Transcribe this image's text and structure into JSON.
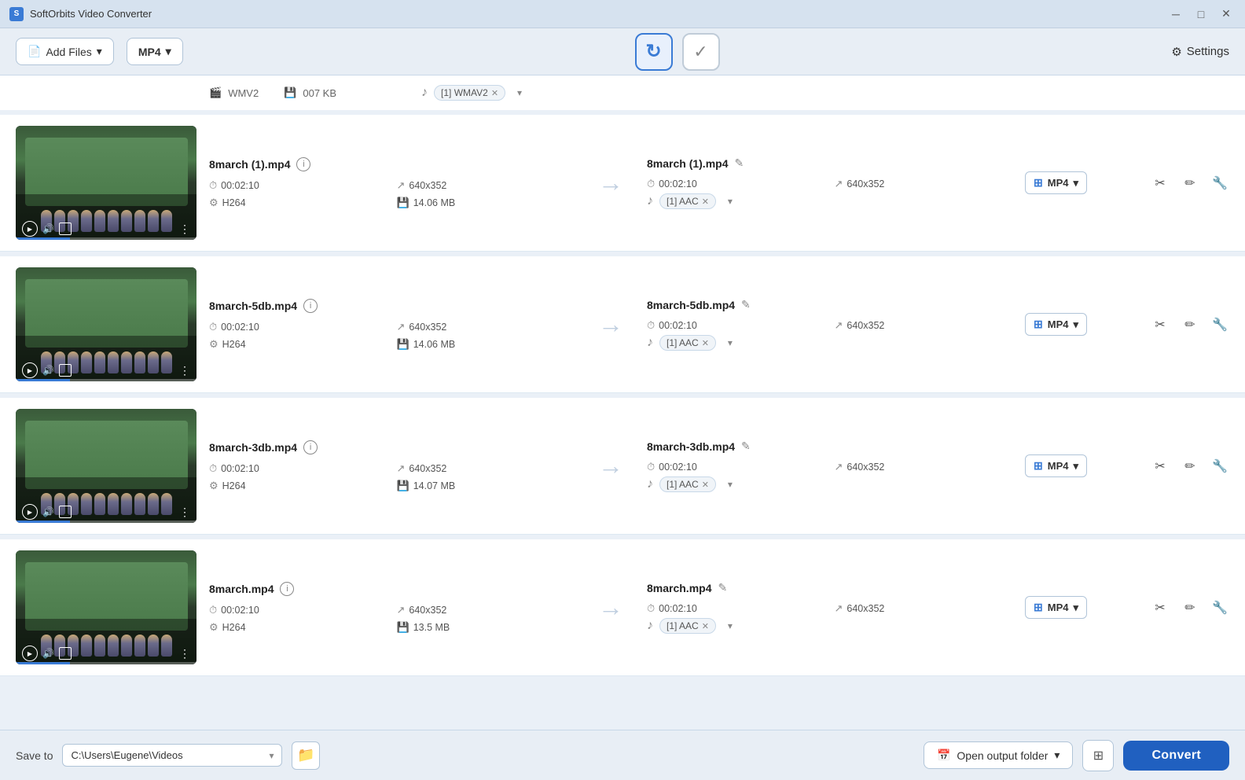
{
  "app": {
    "title": "SoftOrbits Video Converter"
  },
  "titlebar": {
    "minimize": "─",
    "maximize": "□",
    "close": "✕"
  },
  "toolbar": {
    "add_files_label": "Add Files",
    "format_label": "MP4",
    "settings_label": "Settings"
  },
  "partial_row": {
    "codec": "WMV2",
    "size": "007 KB",
    "audio_label": "[1] WMAV2"
  },
  "files": [
    {
      "name": "8march (1).mp4",
      "duration": "00:02:10",
      "resolution": "640x352",
      "codec": "H264",
      "size": "14.06 MB",
      "output_name": "8march (1).mp4",
      "output_duration": "00:02:10",
      "output_resolution": "640x352",
      "audio_label": "[1] AAC",
      "format": "MP4"
    },
    {
      "name": "8march-5db.mp4",
      "duration": "00:02:10",
      "resolution": "640x352",
      "codec": "H264",
      "size": "14.06 MB",
      "output_name": "8march-5db.mp4",
      "output_duration": "00:02:10",
      "output_resolution": "640x352",
      "audio_label": "[1] AAC",
      "format": "MP4"
    },
    {
      "name": "8march-3db.mp4",
      "duration": "00:02:10",
      "resolution": "640x352",
      "codec": "H264",
      "size": "14.07 MB",
      "output_name": "8march-3db.mp4",
      "output_duration": "00:02:10",
      "output_resolution": "640x352",
      "audio_label": "[1] AAC",
      "format": "MP4"
    },
    {
      "name": "8march.mp4",
      "duration": "00:02:10",
      "resolution": "640x352",
      "codec": "H264",
      "size": "13.5 MB",
      "output_name": "8march.mp4",
      "output_duration": "00:02:10",
      "output_resolution": "640x352",
      "audio_label": "[1] AAC",
      "format": "MP4"
    }
  ],
  "bottom": {
    "save_to_label": "Save to",
    "save_path": "C:\\Users\\Eugene\\Videos",
    "open_output_label": "Open output folder",
    "convert_label": "Convert"
  },
  "icons": {
    "play": "▶",
    "volume": "🔊",
    "frame": "⊡",
    "more": "⋮",
    "arrow_right": "→",
    "chevron_down": "∨",
    "info": "i",
    "edit": "✎",
    "scissors": "✂",
    "write": "✏",
    "wrench": "🔧",
    "grid": "⊞",
    "folder": "📁",
    "calendar": "📅",
    "settings": "⚙",
    "add": "＋",
    "rotate": "↻",
    "checkmark": "✓"
  }
}
